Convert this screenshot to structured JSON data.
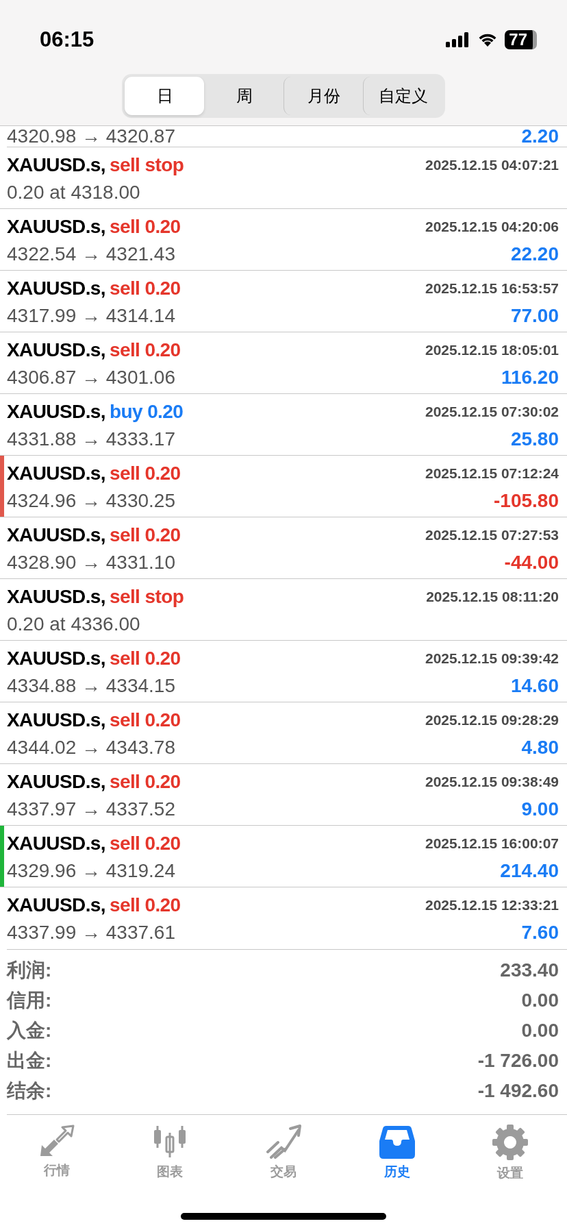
{
  "status_bar": {
    "time": "06:15",
    "battery": "77"
  },
  "period_tabs": [
    {
      "label": "日",
      "selected": true
    },
    {
      "label": "周",
      "selected": false
    },
    {
      "label": "月份",
      "selected": false
    },
    {
      "label": "自定义",
      "selected": false
    }
  ],
  "partial_row": {
    "prices": "4320.98 → 4320.87",
    "profit": "2.20",
    "loss": false
  },
  "deals": [
    {
      "symbol": "XAUUSD.s,",
      "buy": false,
      "order": "sell stop",
      "time": "2025.12.15 04:07:21",
      "prices": "0.20 at 4318.00"
    },
    {
      "symbol": "XAUUSD.s,",
      "buy": false,
      "order": "sell 0.20",
      "time": "2025.12.15 04:20:06",
      "prices": "4322.54 → 4321.43",
      "profit": "22.20",
      "loss": false
    },
    {
      "symbol": "XAUUSD.s,",
      "buy": false,
      "order": "sell 0.20",
      "time": "2025.12.15 16:53:57",
      "prices": "4317.99 → 4314.14",
      "profit": "77.00",
      "loss": false
    },
    {
      "symbol": "XAUUSD.s,",
      "buy": false,
      "order": "sell 0.20",
      "time": "2025.12.15 18:05:01",
      "prices": "4306.87 → 4301.06",
      "profit": "116.20",
      "loss": false
    },
    {
      "symbol": "XAUUSD.s,",
      "buy": true,
      "order": "buy 0.20",
      "time": "2025.12.15 07:30:02",
      "prices": "4331.88 → 4333.17",
      "profit": "25.80",
      "loss": false
    },
    {
      "symbol": "XAUUSD.s,",
      "buy": false,
      "order": "sell 0.20",
      "time": "2025.12.15 07:12:24",
      "prices": "4324.96 → 4330.25",
      "profit": "-105.80",
      "loss": true,
      "color": "#e0584c"
    },
    {
      "symbol": "XAUUSD.s,",
      "buy": false,
      "order": "sell 0.20",
      "time": "2025.12.15 07:27:53",
      "prices": "4328.90 → 4331.10",
      "profit": "-44.00",
      "loss": true
    },
    {
      "symbol": "XAUUSD.s,",
      "buy": false,
      "order": "sell stop",
      "time": "2025.12.15 08:11:20",
      "prices": "0.20 at 4336.00"
    },
    {
      "symbol": "XAUUSD.s,",
      "buy": false,
      "order": "sell 0.20",
      "time": "2025.12.15 09:39:42",
      "prices": "4334.88 → 4334.15",
      "profit": "14.60",
      "loss": false
    },
    {
      "symbol": "XAUUSD.s,",
      "buy": false,
      "order": "sell 0.20",
      "time": "2025.12.15 09:28:29",
      "prices": "4344.02 → 4343.78",
      "profit": "4.80",
      "loss": false
    },
    {
      "symbol": "XAUUSD.s,",
      "buy": false,
      "order": "sell 0.20",
      "time": "2025.12.15 09:38:49",
      "prices": "4337.97 → 4337.52",
      "profit": "9.00",
      "loss": false
    },
    {
      "symbol": "XAUUSD.s,",
      "buy": false,
      "order": "sell 0.20",
      "time": "2025.12.15 16:00:07",
      "prices": "4329.96 → 4319.24",
      "profit": "214.40",
      "loss": false,
      "color": "#1fb53a"
    },
    {
      "symbol": "XAUUSD.s,",
      "buy": false,
      "order": "sell 0.20",
      "time": "2025.12.15 12:33:21",
      "prices": "4337.99 → 4337.61",
      "profit": "7.60",
      "loss": false
    }
  ],
  "summary": [
    {
      "label": "利润:",
      "value": "233.40"
    },
    {
      "label": "信用:",
      "value": "0.00"
    },
    {
      "label": "入金:",
      "value": "0.00"
    },
    {
      "label": "出金:",
      "value": "-1 726.00"
    },
    {
      "label": "结余:",
      "value": "-1 492.60"
    }
  ],
  "tab_bar": [
    {
      "kind": "quotes",
      "label": "行情",
      "selected": false
    },
    {
      "kind": "chart",
      "label": "图表",
      "selected": false
    },
    {
      "kind": "trade",
      "label": "交易",
      "selected": false
    },
    {
      "kind": "history",
      "label": "历史",
      "selected": true
    },
    {
      "kind": "settings",
      "label": "设置",
      "selected": false
    }
  ]
}
